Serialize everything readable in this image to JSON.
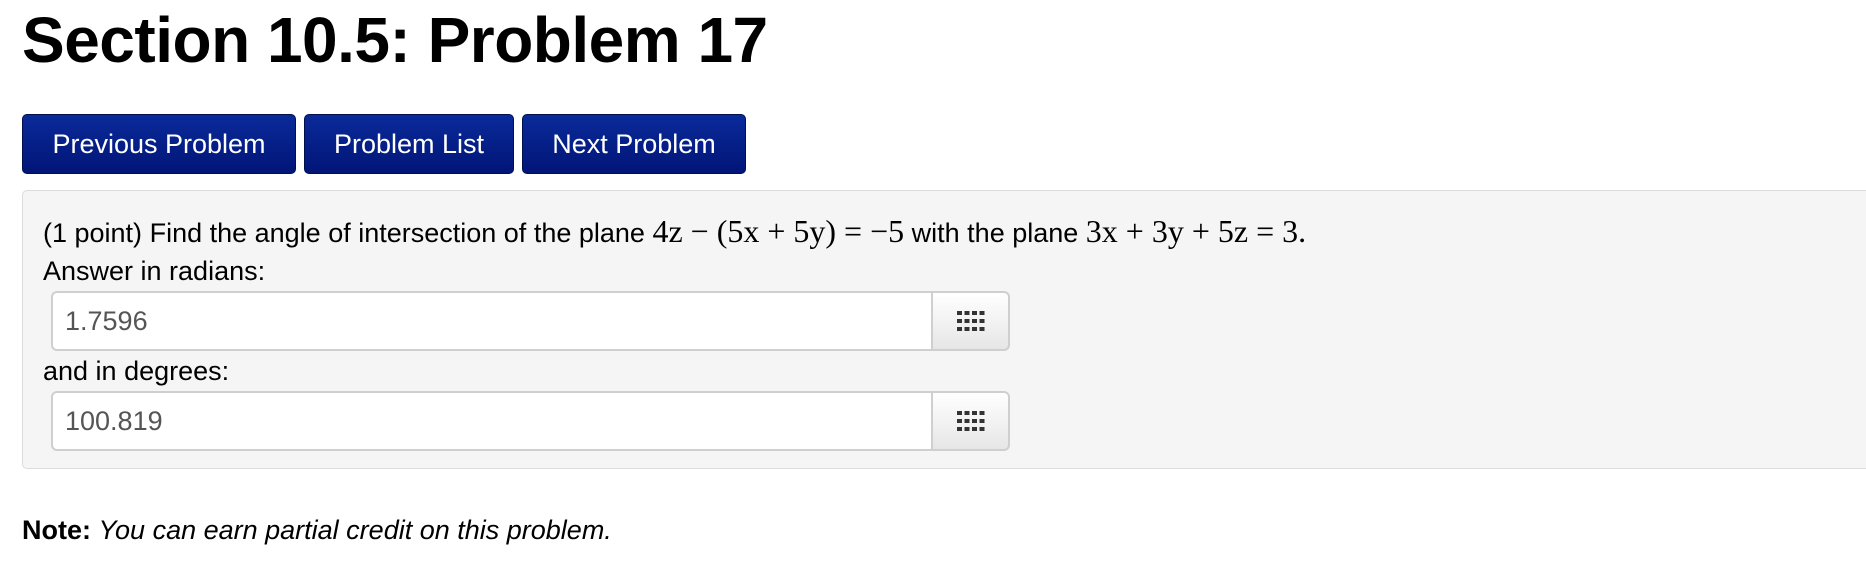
{
  "page": {
    "title": "Section 10.5: Problem 17"
  },
  "nav": {
    "previous_label": "Previous Problem",
    "list_label": "Problem List",
    "next_label": "Next Problem"
  },
  "problem": {
    "points": "(1 point)",
    "text_before": "Find the angle of intersection of the plane",
    "plane1": "4z − (5x + 5y) = −5",
    "text_middle": "with the plane",
    "plane2": "3x + 3y + 5z = 3",
    "text_end": "."
  },
  "answers": {
    "radians": {
      "label": "Answer in radians:",
      "value": "1.7596",
      "palette_icon": "grid-icon"
    },
    "degrees": {
      "label": "and in degrees:",
      "value": "100.819",
      "palette_icon": "grid-icon"
    }
  },
  "note": {
    "label": "Note:",
    "text": "You can earn partial credit on this problem."
  },
  "colors": {
    "button_bg": "#011577",
    "button_text": "#ffffff",
    "problem_bg": "#f5f5f5"
  }
}
